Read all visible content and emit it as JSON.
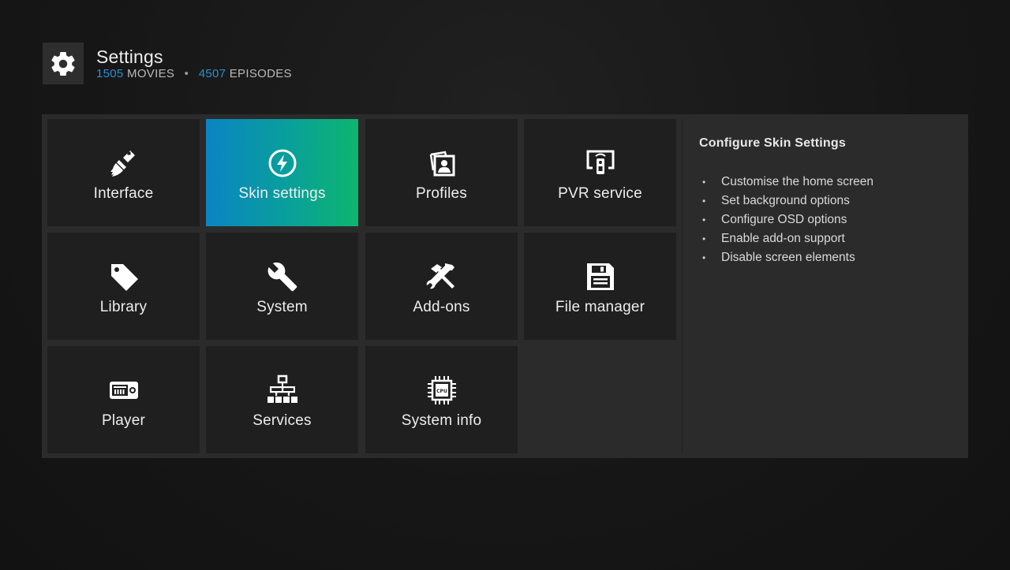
{
  "header": {
    "title": "Settings",
    "movies_count": "1505",
    "movies_label": "MOVIES",
    "separator": "•",
    "episodes_count": "4507",
    "episodes_label": "EPISODES",
    "icon": "gear-icon"
  },
  "tiles": [
    {
      "label": "Interface",
      "icon": "paintbrush-icon",
      "active": false
    },
    {
      "label": "Skin settings",
      "icon": "lightning-circle-icon",
      "active": true
    },
    {
      "label": "Profiles",
      "icon": "profile-photos-icon",
      "active": false
    },
    {
      "label": "PVR service",
      "icon": "pvr-tv-icon",
      "active": false
    },
    {
      "label": "Library",
      "icon": "tag-icon",
      "active": false
    },
    {
      "label": "System",
      "icon": "wrench-icon",
      "active": false
    },
    {
      "label": "Add-ons",
      "icon": "tools-icon",
      "active": false
    },
    {
      "label": "File manager",
      "icon": "floppy-disk-icon",
      "active": false
    },
    {
      "label": "Player",
      "icon": "player-icon",
      "active": false
    },
    {
      "label": "Services",
      "icon": "network-hierarchy-icon",
      "active": false
    },
    {
      "label": "System info",
      "icon": "cpu-chip-icon",
      "active": false
    }
  ],
  "cpu_text": "CPU",
  "info": {
    "title": "Configure Skin Settings",
    "items": [
      "Customise the home screen",
      "Set background options",
      "Configure OSD options",
      "Enable add-on support",
      "Disable screen elements"
    ]
  },
  "colors": {
    "accent_blue": "#2a8fd1",
    "active_gradient_start": "#0b84c4",
    "active_gradient_end": "#0db56e"
  }
}
